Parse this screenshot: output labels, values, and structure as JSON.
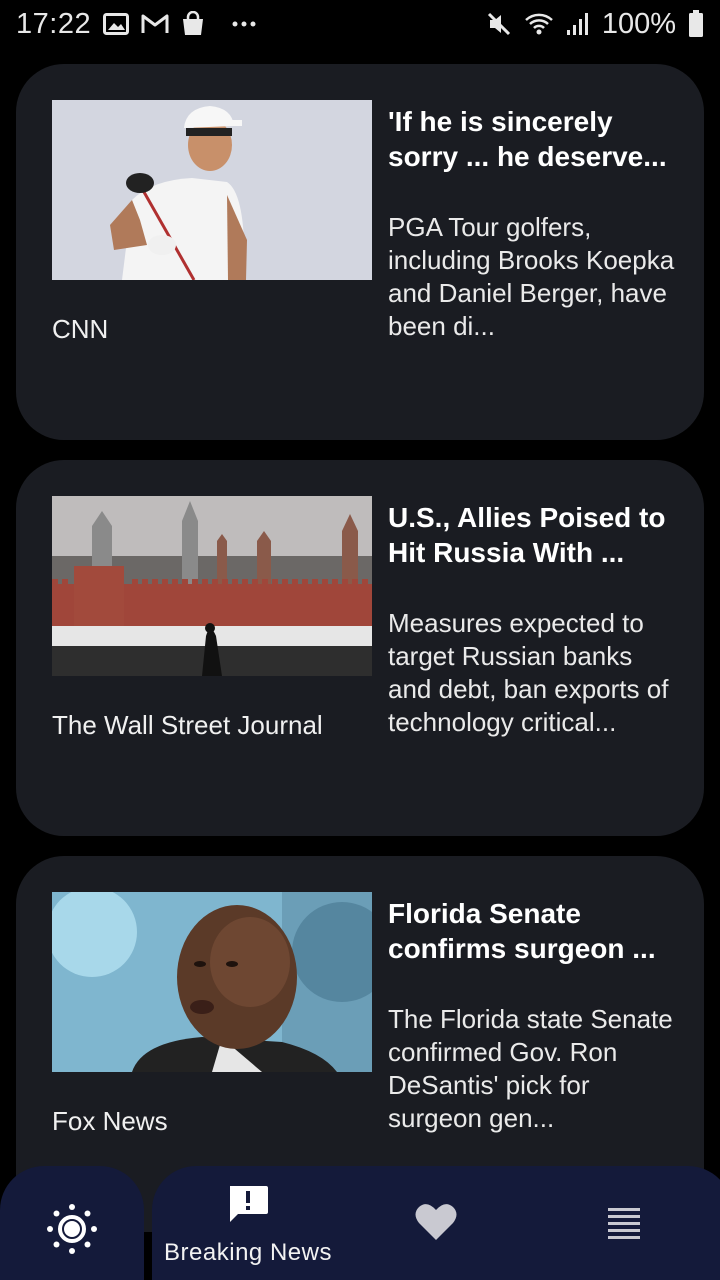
{
  "status_bar": {
    "time": "17:22",
    "left_icons": [
      "image-icon",
      "gmail-icon",
      "shopping-bag-icon",
      "more-dots-icon"
    ],
    "right_icons": [
      "mute-icon",
      "wifi-icon",
      "signal-icon",
      "battery-icon"
    ],
    "battery": "100%"
  },
  "articles": [
    {
      "source": "CNN",
      "headline": "'If he is sincerely sorry ... he deserve...",
      "summary": "PGA Tour golfers, including Brooks Koepka and Daniel Berger, have been di...",
      "image": "golfer-photo"
    },
    {
      "source": "The Wall Street Journal",
      "headline": "U.S., Allies Poised to Hit Russia With ...",
      "summary": "Measures expected to target Russian banks and debt, ban exports of technology critical...",
      "image": "kremlin-photo"
    },
    {
      "source": "Fox News",
      "headline": "Florida Senate confirms surgeon ...",
      "summary": "The Florida state Senate confirmed Gov. Ron DeSantis' pick for surgeon gen...",
      "image": "portrait-photo"
    }
  ],
  "bottom_nav": {
    "items": [
      {
        "icon": "sun-icon"
      },
      {
        "icon": "breaking-news-icon",
        "label": "Breaking News"
      },
      {
        "icon": "heart-icon"
      },
      {
        "icon": "menu-icon"
      }
    ]
  },
  "colors": {
    "background": "#000000",
    "card": "#1a1c22",
    "nav": "#141a3a",
    "text": "#ffffff"
  }
}
